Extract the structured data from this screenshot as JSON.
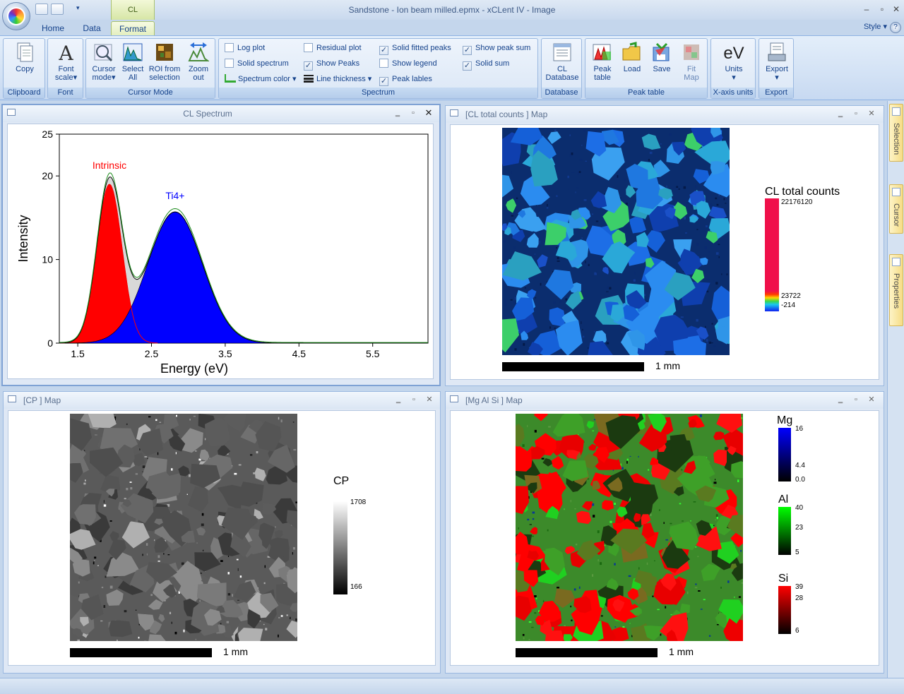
{
  "window": {
    "title": "Sandstone - Ion beam milled.epmx - xCLent IV - Image",
    "context_tab_group": "CL",
    "style_menu": "Style",
    "help": "?"
  },
  "tabs": [
    {
      "label": "Home"
    },
    {
      "label": "Data"
    },
    {
      "label": "Format"
    }
  ],
  "ribbon": {
    "groups": [
      {
        "label": "Clipboard"
      },
      {
        "label": "Font"
      },
      {
        "label": "Cursor Mode"
      },
      {
        "label": "Spectrum"
      },
      {
        "label": "Database"
      },
      {
        "label": "Peak table"
      },
      {
        "label": "X-axis units"
      },
      {
        "label": "Export"
      }
    ],
    "buttons": {
      "copy": "Copy",
      "font_scale_1": "Font",
      "font_scale_2": "scale",
      "font_glyph": "A",
      "cursor_mode_1": "Cursor",
      "cursor_mode_2": "mode",
      "select_all_1": "Select",
      "select_all_2": "All",
      "roi_1": "ROI from",
      "roi_2": "selection",
      "zoom_out_1": "Zoom",
      "zoom_out_2": "out",
      "cl_db_1": "CL",
      "cl_db_2": "Database",
      "peak_table_1": "Peak",
      "peak_table_2": "table",
      "load": "Load",
      "save": "Save",
      "fit_map_1": "Fit",
      "fit_map_2": "Map",
      "units_glyph": "eV",
      "units": "Units",
      "export": "Export"
    },
    "checkboxes": [
      {
        "label": "Log plot",
        "checked": false
      },
      {
        "label": "Solid spectrum",
        "checked": false
      },
      {
        "label": "Residual plot",
        "checked": false
      },
      {
        "label": "Show Peaks",
        "checked": true
      },
      {
        "label": "Solid fitted peaks",
        "checked": true
      },
      {
        "label": "Show legend",
        "checked": false
      },
      {
        "label": "Peak lables",
        "checked": true
      },
      {
        "label": "Show peak sum",
        "checked": true
      },
      {
        "label": "Solid sum",
        "checked": true
      }
    ],
    "dropdowns": {
      "spectrum_color": "Spectrum color",
      "line_thickness": "Line thickness"
    }
  },
  "panels": {
    "spectrum": {
      "title": "CL Spectrum"
    },
    "cl_map": {
      "title": "[CL total counts ] Map",
      "legend_title": "CL total counts",
      "max": "22176120",
      "mid": "23722",
      "min": "-214",
      "scale": "1 mm"
    },
    "cp_map": {
      "title": "[CP ] Map",
      "legend_title": "CP",
      "max": "1708",
      "min": "166",
      "scale": "1 mm"
    },
    "mgalsi_map": {
      "title": "[Mg Al Si ] Map",
      "scale": "1 mm",
      "mg": {
        "name": "Mg",
        "max": "16",
        "mid": "4.4",
        "min": "0.0"
      },
      "al": {
        "name": "Al",
        "max": "40",
        "mid": "23",
        "min": "5"
      },
      "si": {
        "name": "Si",
        "max": "39",
        "mid": "28",
        "min": "6"
      }
    }
  },
  "dock": [
    {
      "label": "Selection"
    },
    {
      "label": "Cursor"
    },
    {
      "label": "Properties"
    }
  ],
  "chart_data": {
    "type": "area",
    "title": "",
    "xlabel": "Energy (eV)",
    "ylabel": "Intensity",
    "xlim": [
      1.25,
      6.25
    ],
    "ylim": [
      0,
      25
    ],
    "x_ticks": [
      "1.5",
      "2.5",
      "3.5",
      "4.5",
      "5.5"
    ],
    "y_ticks": [
      "0",
      "10",
      "20",
      "25"
    ],
    "peaks": [
      {
        "name": "Intrinsic",
        "center": 1.93,
        "height": 19.0,
        "sigma": 0.17,
        "color": "#ff0000"
      },
      {
        "name": "Ti4+",
        "center": 2.82,
        "height": 15.7,
        "sigma": 0.37,
        "color": "#0000ff"
      }
    ],
    "series": [
      {
        "name": "Intrinsic",
        "color": "#ff0000"
      },
      {
        "name": "Ti4+",
        "color": "#0000ff"
      }
    ]
  }
}
